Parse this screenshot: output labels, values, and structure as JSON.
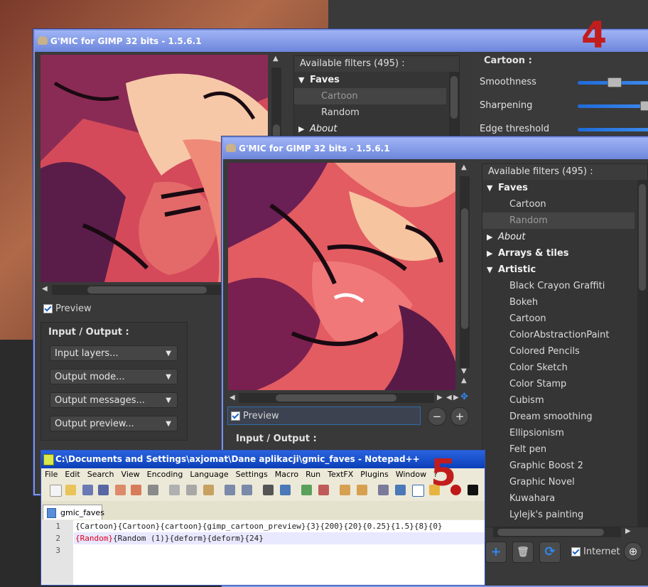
{
  "colors": {
    "accent": "#2f87ee",
    "title_blue": "#6d86db",
    "panel": "#393939",
    "red_mark": "#c21d1d"
  },
  "back_window": {
    "title": "G'MIC for GIMP 32 bits - 1.5.6.1",
    "preview_label": "Preview",
    "io_title": "Input / Output :",
    "io_combos": [
      "Input layers...",
      "Output mode...",
      "Output messages...",
      "Output preview..."
    ],
    "filters_header": "Available filters (495) :",
    "filters": [
      {
        "label": "Faves",
        "type": "category",
        "icon": "triangle-down"
      },
      {
        "label": "Cartoon",
        "type": "selected"
      },
      {
        "label": "Random",
        "type": "item"
      },
      {
        "label": "About",
        "type": "category-italic",
        "icon": "triangle-right"
      }
    ],
    "params_title": "Cartoon :",
    "params": [
      {
        "label": "Smoothness",
        "level": 0.17
      },
      {
        "label": "Sharpening",
        "level": 0.98
      },
      {
        "label": "Edge threshold",
        "level": 1.0
      }
    ]
  },
  "front_window": {
    "title": "G'MIC for GIMP 32 bits - 1.5.6.1",
    "preview_label": "Preview",
    "io_title": "Input / Output :",
    "filters_header": "Available filters (495) :",
    "filters": [
      {
        "label": "Faves",
        "type": "category",
        "icon": "triangle-down"
      },
      {
        "label": "Cartoon",
        "type": "item"
      },
      {
        "label": "Random",
        "type": "selected"
      },
      {
        "label": "About",
        "type": "category-italic",
        "icon": "triangle-right"
      },
      {
        "label": "Arrays & tiles",
        "type": "category",
        "icon": "triangle-right"
      },
      {
        "label": "Artistic",
        "type": "category",
        "icon": "triangle-down"
      },
      {
        "label": "Black Crayon Graffiti",
        "type": "item"
      },
      {
        "label": "Bokeh",
        "type": "item"
      },
      {
        "label": "Cartoon",
        "type": "item"
      },
      {
        "label": "ColorAbstractionPaint",
        "type": "item"
      },
      {
        "label": "Colored Pencils",
        "type": "item"
      },
      {
        "label": "Color Sketch",
        "type": "item"
      },
      {
        "label": "Color Stamp",
        "type": "item"
      },
      {
        "label": "Cubism",
        "type": "item"
      },
      {
        "label": "Dream smoothing",
        "type": "item"
      },
      {
        "label": "Ellipsionism",
        "type": "item"
      },
      {
        "label": "Felt pen",
        "type": "item"
      },
      {
        "label": "Graphic Boost 2",
        "type": "item"
      },
      {
        "label": "Graphic Novel",
        "type": "item"
      },
      {
        "label": "Kuwahara",
        "type": "item"
      },
      {
        "label": "Lylejk's painting",
        "type": "item"
      }
    ],
    "internet_label": "Internet",
    "zoom_out": "−",
    "zoom_in": "+"
  },
  "marks": {
    "four": "4",
    "five": "5"
  },
  "notepad": {
    "title": "C:\\Documents and Settings\\axjomat\\Dane aplikacji\\gmic_faves - Notepad++",
    "menu": [
      "File",
      "Edit",
      "Search",
      "View",
      "Encoding",
      "Language",
      "Settings",
      "Macro",
      "Run",
      "TextFX",
      "Plugins",
      "Window",
      "?"
    ],
    "tab": "gmic_faves",
    "line_numbers": [
      "1",
      "2",
      "3"
    ],
    "line1": "{Cartoon}{Cartoon}{cartoon}{gimp_cartoon_preview}{3}{200}{20}{0.25}{1.5}{8}{0}",
    "line2_red": "{Random}",
    "line2_rest": "{Random (1)}{deform}{deform}{24}",
    "line3": ""
  }
}
